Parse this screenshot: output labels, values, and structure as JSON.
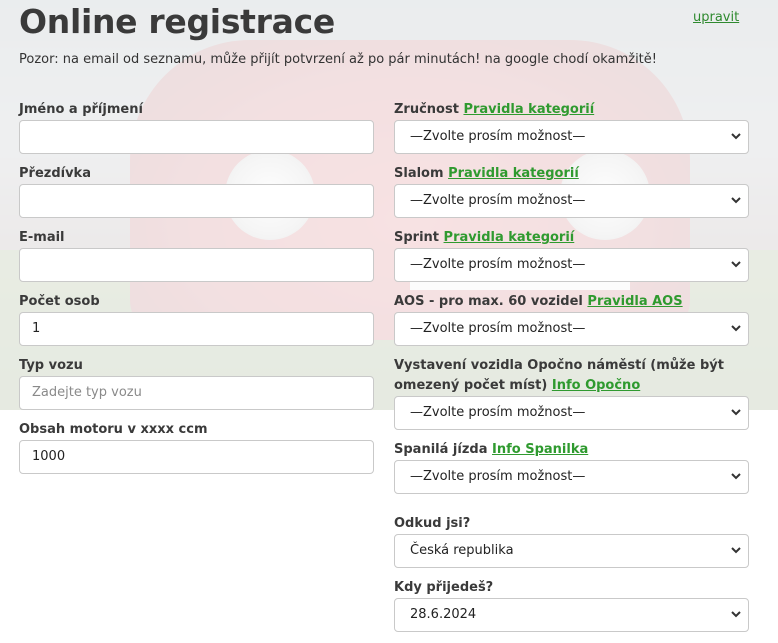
{
  "page": {
    "title": "Online registrace",
    "edit_link": "upravit",
    "notice": "Pozor: na email od seznamu, může přijít potvrzení až po pár minutách! na google chodí okamžitě!"
  },
  "left": {
    "name": {
      "label": "Jméno a příjmení",
      "value": ""
    },
    "nickname": {
      "label": "Přezdívka",
      "value": ""
    },
    "email": {
      "label": "E-mail",
      "value": ""
    },
    "persons": {
      "label": "Počet osob",
      "value": "1"
    },
    "car_type": {
      "label": "Typ vozu",
      "placeholder": "Zadejte typ vozu"
    },
    "engine": {
      "label": "Obsah motoru v xxxx ccm",
      "value": "1000"
    }
  },
  "right": {
    "skill": {
      "label": "Zručnost",
      "link": "Pravidla kategorií",
      "selected": "—Zvolte prosím možnost—"
    },
    "slalom": {
      "label": "Slalom",
      "link": "Pravidla kategorií",
      "selected": "—Zvolte prosím možnost—"
    },
    "sprint": {
      "label": "Sprint",
      "link": "Pravidla kategorií",
      "selected": "—Zvolte prosím možnost—"
    },
    "aos": {
      "label": "AOS - pro max. 60 vozidel",
      "link": "Pravidla AOS",
      "selected": "—Zvolte prosím možnost—"
    },
    "exhibition": {
      "label_line1": "Vystavení vozidla Opočno náměstí (může být",
      "label_line2": "omezený počet míst)",
      "link": "Info Opočno",
      "selected": "—Zvolte prosím možnost—"
    },
    "ride": {
      "label": "Spanilá jízda",
      "link": "Info Spanilka",
      "selected": "—Zvolte prosím možnost—"
    },
    "origin": {
      "label": "Odkud jsi?",
      "selected": "Česká republika"
    },
    "arrival": {
      "label": "Kdy přijedeš?",
      "selected": "28.6.2024"
    }
  },
  "icons": {
    "select_arrow": "chevron-down-icon"
  },
  "colors": {
    "link_green": "#2f9a2f",
    "title": "#3a3a3a"
  }
}
